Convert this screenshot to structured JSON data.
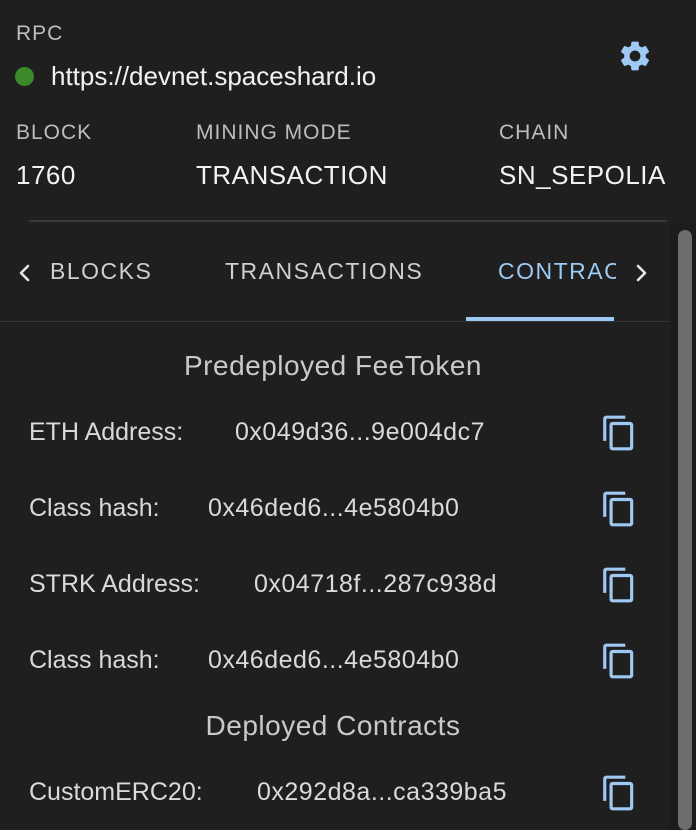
{
  "rpc": {
    "label": "RPC",
    "url": "https://devnet.spaceshard.io",
    "status_color": "#3a8a2c"
  },
  "stats": {
    "block": {
      "label": "BLOCK",
      "value": "1760"
    },
    "mining_mode": {
      "label": "MINING MODE",
      "value": "TRANSACTION"
    },
    "chain": {
      "label": "CHAIN",
      "value": "SN_SEPOLIA"
    }
  },
  "tabs": {
    "items": [
      {
        "label": "BLOCKS"
      },
      {
        "label": "TRANSACTIONS"
      },
      {
        "label": "CONTRACTS"
      }
    ],
    "active_index": 2,
    "accent_color": "#9ec9f2"
  },
  "contracts": {
    "predeployed_title": "Predeployed FeeToken",
    "predeployed": [
      {
        "label": "ETH Address:",
        "value": "0x049d36...9e004dc7"
      },
      {
        "label": "Class hash:",
        "value": "0x46ded6...4e5804b0"
      },
      {
        "label": "STRK Address:",
        "value": "0x04718f...287c938d"
      },
      {
        "label": "Class hash:",
        "value": "0x46ded6...4e5804b0"
      }
    ],
    "deployed_title": "Deployed Contracts",
    "deployed": [
      {
        "label": "CustomERC20:",
        "value": "0x292d8a...ca339ba5"
      }
    ]
  },
  "icons": {
    "settings": "gear-icon",
    "copy": "copy-icon",
    "prev": "chevron-left-icon",
    "next": "chevron-right-icon"
  }
}
